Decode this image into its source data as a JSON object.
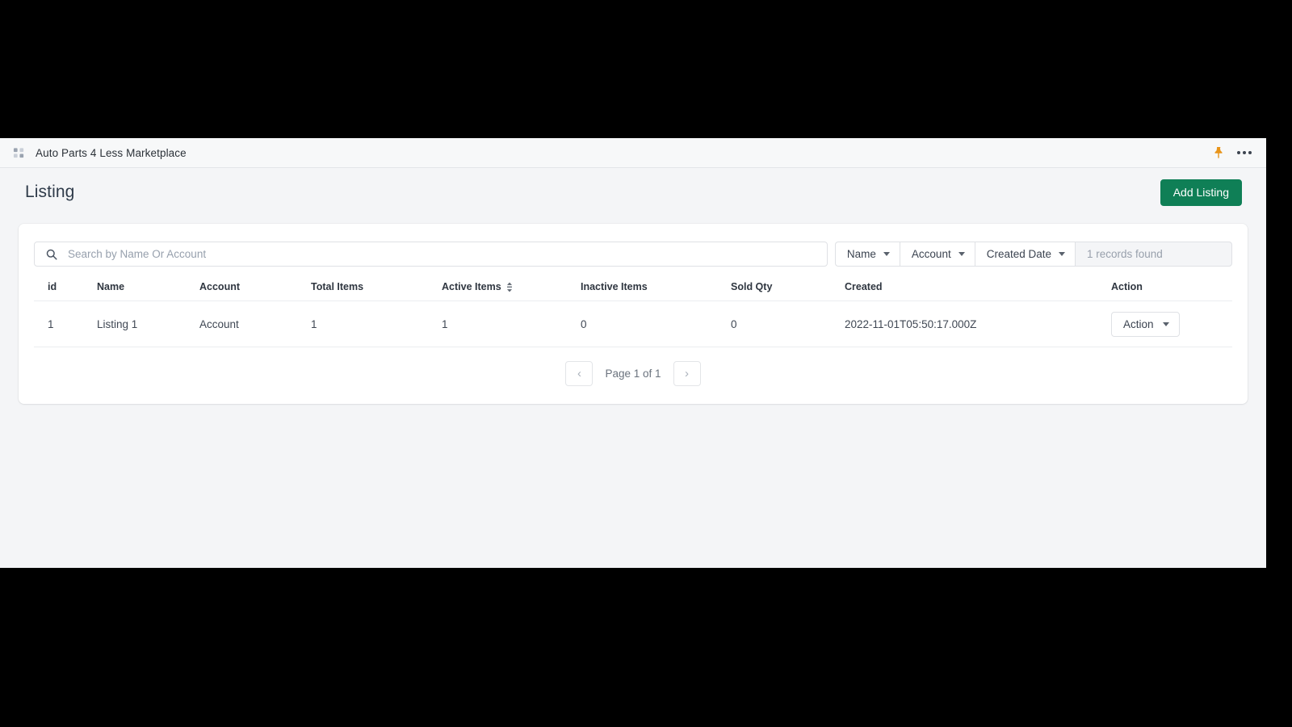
{
  "appbar": {
    "icon": "app-grid-icon",
    "title": "Auto Parts 4 Less Marketplace",
    "pin_icon": "pin-icon",
    "overflow_icon": "ellipsis-icon"
  },
  "header": {
    "title": "Listing",
    "primary_button": "Add Listing",
    "primary_color": "#0f7f56"
  },
  "toolbar": {
    "search_placeholder": "Search by Name Or Account",
    "search_value": "",
    "search_icon": "search-icon",
    "filters": [
      {
        "label": "Name"
      },
      {
        "label": "Account"
      },
      {
        "label": "Created Date"
      }
    ],
    "records_found": "1 records found"
  },
  "table": {
    "columns": [
      {
        "label": "id",
        "sortable": false
      },
      {
        "label": "Name",
        "sortable": false
      },
      {
        "label": "Account",
        "sortable": false
      },
      {
        "label": "Total Items",
        "sortable": false
      },
      {
        "label": "Active Items",
        "sortable": true
      },
      {
        "label": "Inactive Items",
        "sortable": false
      },
      {
        "label": "Sold Qty",
        "sortable": false
      },
      {
        "label": "Created",
        "sortable": false
      },
      {
        "label": "Action",
        "sortable": false
      }
    ],
    "rows": [
      {
        "id": "1",
        "name": "Listing 1",
        "account": "Account",
        "total_items": "1",
        "active_items": "1",
        "inactive_items": "0",
        "sold_qty": "0",
        "created": "2022-11-01T05:50:17.000Z",
        "action_label": "Action"
      }
    ]
  },
  "pagination": {
    "prev": "‹",
    "label": "Page 1 of 1",
    "next": "›"
  }
}
